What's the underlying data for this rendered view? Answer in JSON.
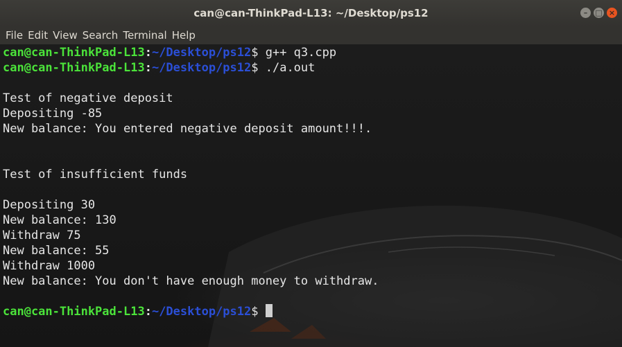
{
  "window": {
    "title": "can@can-ThinkPad-L13: ~/Desktop/ps12",
    "controls": [
      "–",
      "□",
      "×"
    ]
  },
  "menu": [
    "File",
    "Edit",
    "View",
    "Search",
    "Terminal",
    "Help"
  ],
  "terminal": {
    "colors": {
      "user": "#4be33a",
      "path": "#2b4fd6",
      "text": "#e6e6e6"
    },
    "lines": [
      {
        "type": "prompt",
        "user": "can@can-ThinkPad-L13",
        "sep": ":",
        "path": "~/Desktop/ps12",
        "symbol": "$ ",
        "cmd": "g++ q3.cpp"
      },
      {
        "type": "prompt",
        "user": "can@can-ThinkPad-L13",
        "sep": ":",
        "path": "~/Desktop/ps12",
        "symbol": "$ ",
        "cmd": "./a.out"
      },
      {
        "type": "text",
        "text": ""
      },
      {
        "type": "text",
        "text": "Test of negative deposit"
      },
      {
        "type": "text",
        "text": "Depositing -85"
      },
      {
        "type": "text",
        "text": "New balance: You entered negative deposit amount!!!."
      },
      {
        "type": "text",
        "text": ""
      },
      {
        "type": "text",
        "text": ""
      },
      {
        "type": "text",
        "text": "Test of insufficient funds"
      },
      {
        "type": "text",
        "text": ""
      },
      {
        "type": "text",
        "text": "Depositing 30"
      },
      {
        "type": "text",
        "text": "New balance: 130"
      },
      {
        "type": "text",
        "text": "Withdraw 75"
      },
      {
        "type": "text",
        "text": "New balance: 55"
      },
      {
        "type": "text",
        "text": "Withdraw 1000"
      },
      {
        "type": "text",
        "text": "New balance: You don't have enough money to withdraw."
      },
      {
        "type": "text",
        "text": ""
      },
      {
        "type": "prompt",
        "user": "can@can-ThinkPad-L13",
        "sep": ":",
        "path": "~/Desktop/ps12",
        "symbol": "$ ",
        "cmd": "",
        "cursor": true
      }
    ]
  }
}
